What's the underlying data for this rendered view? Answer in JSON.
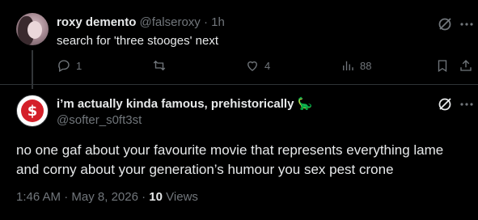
{
  "reply": {
    "display_name": "roxy demento",
    "handle": "@falseroxy",
    "separator": "·",
    "time": "1h",
    "text": "search for 'three stooges' next",
    "actions": {
      "replies": "1",
      "reposts": "",
      "likes": "4",
      "views": "88"
    }
  },
  "main": {
    "display_name": "i’m actually kinda famous, prehistorically",
    "name_emoji": "🦕",
    "handle": "@softer_s0ft3st",
    "text": "no one gaf about your favourite movie that represents everything lame and corny about your generation’s humour you sex pest crone",
    "time": "1:46 AM",
    "date": "May 8, 2026",
    "dot": "·",
    "views_count": "10",
    "views_label": "Views"
  },
  "colors": {
    "background": "#000000",
    "text_primary": "#e7e9ea",
    "text_secondary": "#71767b",
    "divider": "#2f3336"
  },
  "icons": [
    "grok-icon",
    "more-icon",
    "reply-icon",
    "repost-icon",
    "like-icon",
    "views-icon",
    "bookmark-icon",
    "share-icon"
  ]
}
